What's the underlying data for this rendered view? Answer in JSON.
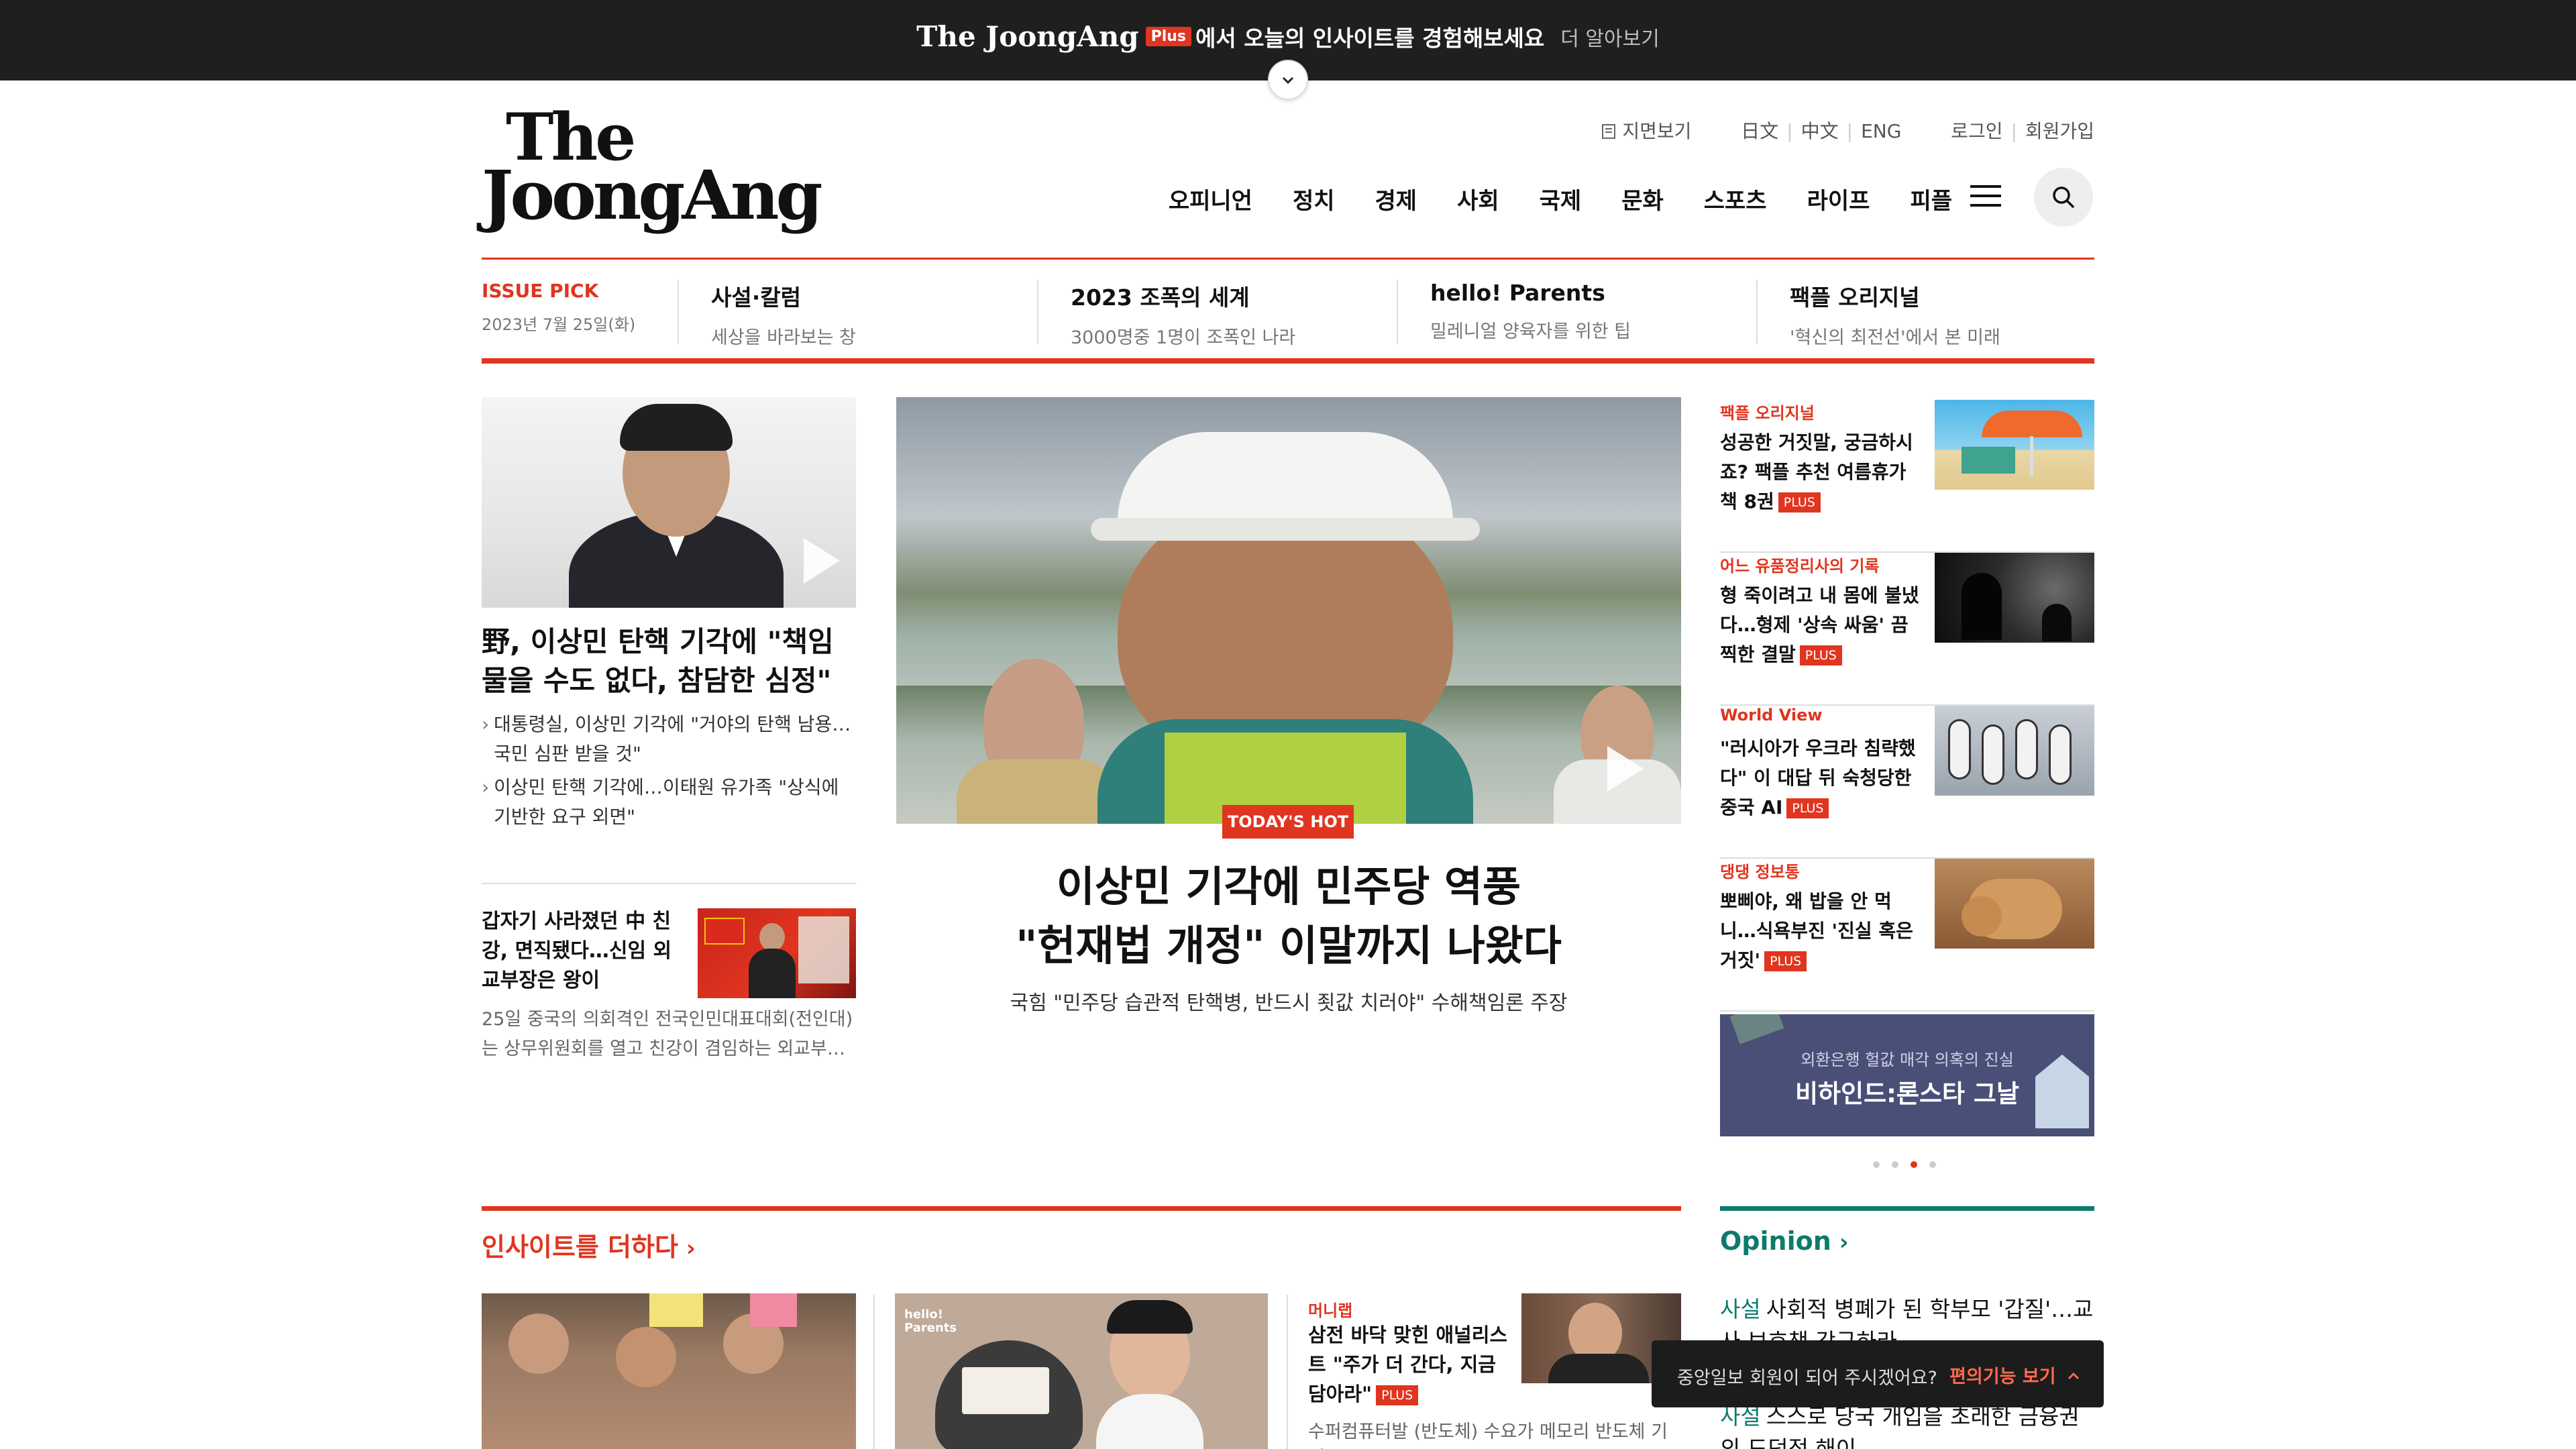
{
  "promo": {
    "brand": "The JoongAng",
    "plus_badge": "Plus",
    "message": "에서 오늘의 인사이트를 경험해보세요",
    "more_link": "더 알아보기"
  },
  "header": {
    "logo_line1": "The",
    "logo_line2": "JoongAng",
    "util_links": {
      "paper_view": "지면보기",
      "japanese": "日文",
      "chinese": "中文",
      "english": "ENG",
      "login": "로그인",
      "signup": "회원가입"
    },
    "nav": [
      "오피니언",
      "정치",
      "경제",
      "사회",
      "국제",
      "문화",
      "스포츠",
      "라이프",
      "피플"
    ]
  },
  "issue_pick": {
    "label": "ISSUE PICK",
    "date": "2023년 7월 25일(화)",
    "items": [
      {
        "title": "사설·칼럼",
        "subtitle": "세상을 바라보는 창"
      },
      {
        "title": "2023 조폭의 세계",
        "subtitle": "3000명중 1명이 조폭인 나라"
      },
      {
        "title": "hello! Parents",
        "subtitle": "밀레니얼 양육자를 위한 팁"
      },
      {
        "title": "팩플 오리지널",
        "subtitle": "'혁신의 최전선'에서 본 미래"
      }
    ]
  },
  "left": {
    "lead_title": "野, 이상민 탄핵 기각에 \"책임 물을 수도 없다, 참담한 심정\"",
    "bullets": [
      "대통령실, 이상민 기각에 \"거야의 탄핵 남용…국민 심판 받을 것\"",
      "이상민 탄핵 기각에…이태원 유가족 \"상식에 기반한 요구 외면\""
    ],
    "sub_title": "갑자기 사라졌던 中 친강, 면직됐다…신임 외교부장은 왕이",
    "sub_desc": "25일 중국의 의회격인 전국인민대표대회(전인대)는 상무위원회를 열고 친강이 겸임하는 외교부…"
  },
  "hero": {
    "badge": "TODAY'S HOT",
    "title_line1": "이상민 기각에 민주당 역풍",
    "title_line2": "\"헌재법 개정\" 이말까지 나왔다",
    "subtitle": "국힘 \"민주당 습관적 탄핵병, 반드시 죗값 치러야\" 수해책임론 주장"
  },
  "right": {
    "items": [
      {
        "category": "팩플 오리지널",
        "title": "성공한 거짓말, 궁금하시죠? 팩플 추천 여름휴가 책 8권",
        "plus": "PLUS"
      },
      {
        "category": "어느 유품정리사의 기록",
        "title": "형 죽이려고 내 몸에 불냈다…형제 '상속 싸움' 끔찍한 결말",
        "plus": "PLUS"
      },
      {
        "category": "World View",
        "title": "\"러시아가 우크라 침략했다\" 이 대답 뒤 숙청당한 중국 AI",
        "plus": "PLUS"
      },
      {
        "category": "댕댕 정보통",
        "title": "뽀삐야, 왜 밥을 안 먹니…식욕부진 '진실 혹은 거짓'",
        "plus": "PLUS"
      }
    ],
    "banner_subtitle": "외환은행 헐값 매각 의혹의 진실",
    "banner_title": "비하인드:론스타 그날"
  },
  "insight": {
    "section_title": "인사이트를 더하다",
    "card3_category": "머니랩",
    "card3_title": "삼전 바닥 맞힌 애널리스트 \"주가 더 간다, 지금 담아라\"",
    "card3_plus": "PLUS",
    "card3_desc": "수퍼컴퓨터발 (반도체) 수요가 메모리 반도체 기업",
    "card2_logo": "hello! Parents"
  },
  "opinion": {
    "section_title": "Opinion",
    "items": [
      {
        "tag": "사설",
        "text": "사회적 병폐가 된 학부모 '갑질'…교사 보호책 강구하라"
      },
      {
        "tag": "사설",
        "text": "스스로 당국 개입을 초래한 금융권의 도덕적 해이"
      }
    ]
  },
  "toast": {
    "message": "중앙일보 회원이 되어 주시겠어요?",
    "button": "편의기능 보기"
  },
  "colors": {
    "accent": "#e0351f",
    "opinion": "#0c7b6c",
    "promo_bg": "#1f1f1f",
    "banner_bg": "#4a4f78"
  }
}
